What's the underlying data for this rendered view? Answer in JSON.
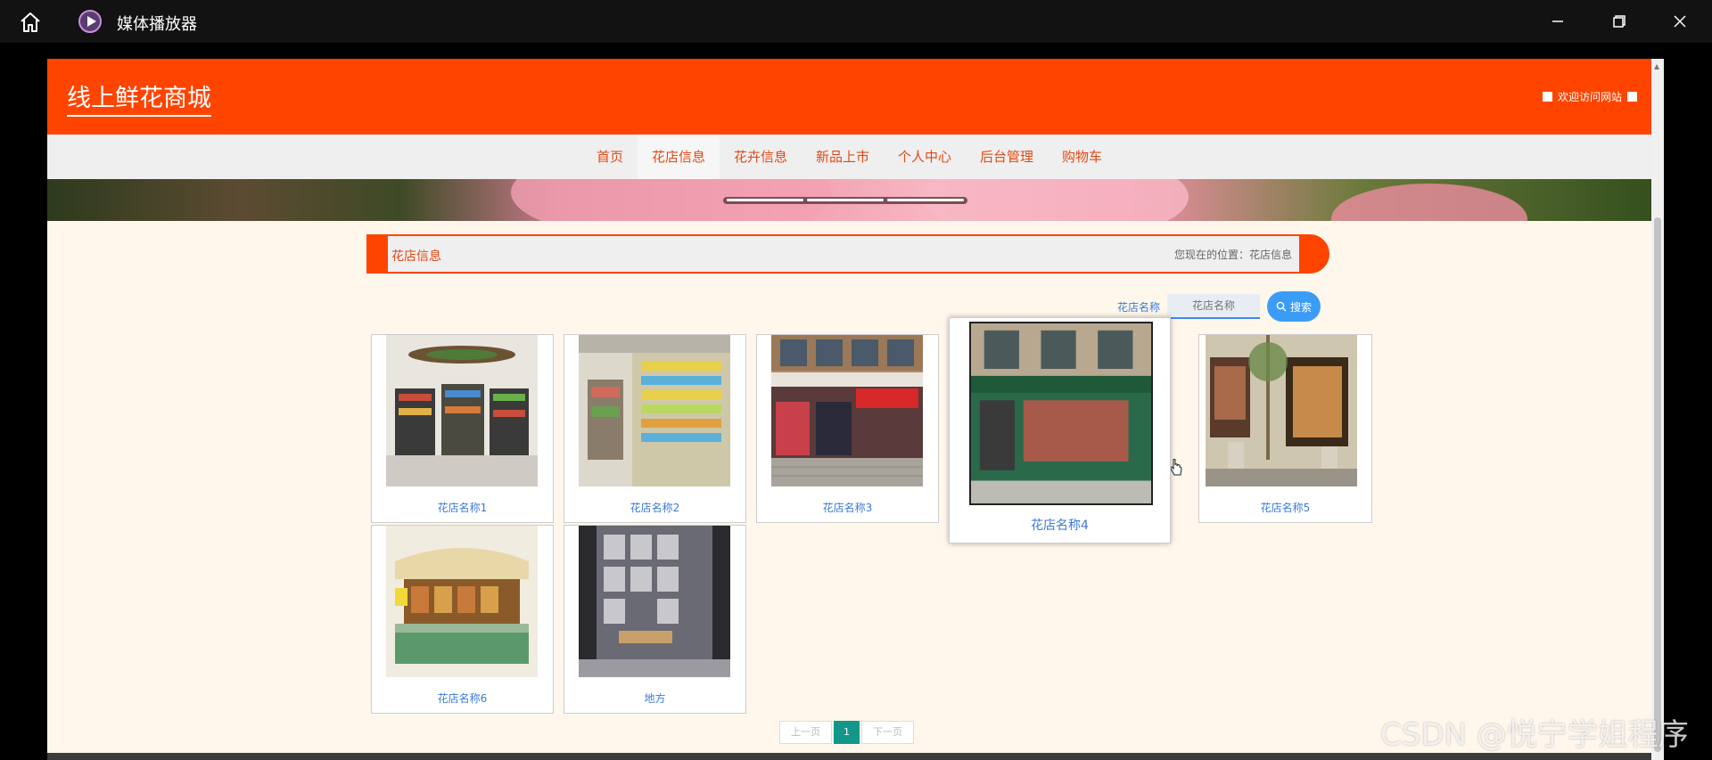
{
  "window": {
    "app_title": "媒体播放器",
    "icons": [
      "home-icon",
      "media-player-icon",
      "minimize-icon",
      "maximize-icon",
      "close-icon"
    ]
  },
  "site": {
    "title": "线上鲜花商城",
    "welcome": "欢迎访问网站",
    "accent_color": "#ff4400"
  },
  "nav": {
    "items": [
      {
        "label": "首页",
        "active": false
      },
      {
        "label": "花店信息",
        "active": true
      },
      {
        "label": "花卉信息",
        "active": false
      },
      {
        "label": "新品上市",
        "active": false
      },
      {
        "label": "个人中心",
        "active": false
      },
      {
        "label": "后台管理",
        "active": false
      },
      {
        "label": "购物车",
        "active": false
      }
    ]
  },
  "section": {
    "title": "花店信息",
    "breadcrumb": "您现在的位置：花店信息"
  },
  "search": {
    "label": "花店名称",
    "placeholder": "花店名称",
    "button_label": "搜索"
  },
  "cards": [
    {
      "name": "花店名称1",
      "image": "supermarket-interior"
    },
    {
      "name": "花店名称2",
      "image": "store-aisle"
    },
    {
      "name": "花店名称3",
      "image": "street-storefront"
    },
    {
      "name": "花店名称4",
      "image": "green-corner-shop",
      "hovered": true
    },
    {
      "name": "花店名称5",
      "image": "flower-shop-front"
    },
    {
      "name": "花店名称6",
      "image": "shop-counter"
    },
    {
      "name": "地方",
      "image": "bookshelf-room"
    }
  ],
  "pagination": {
    "prev": "上一页",
    "current": "1",
    "next": "下一页"
  },
  "watermark": "CSDN @悦宁学姐程序"
}
